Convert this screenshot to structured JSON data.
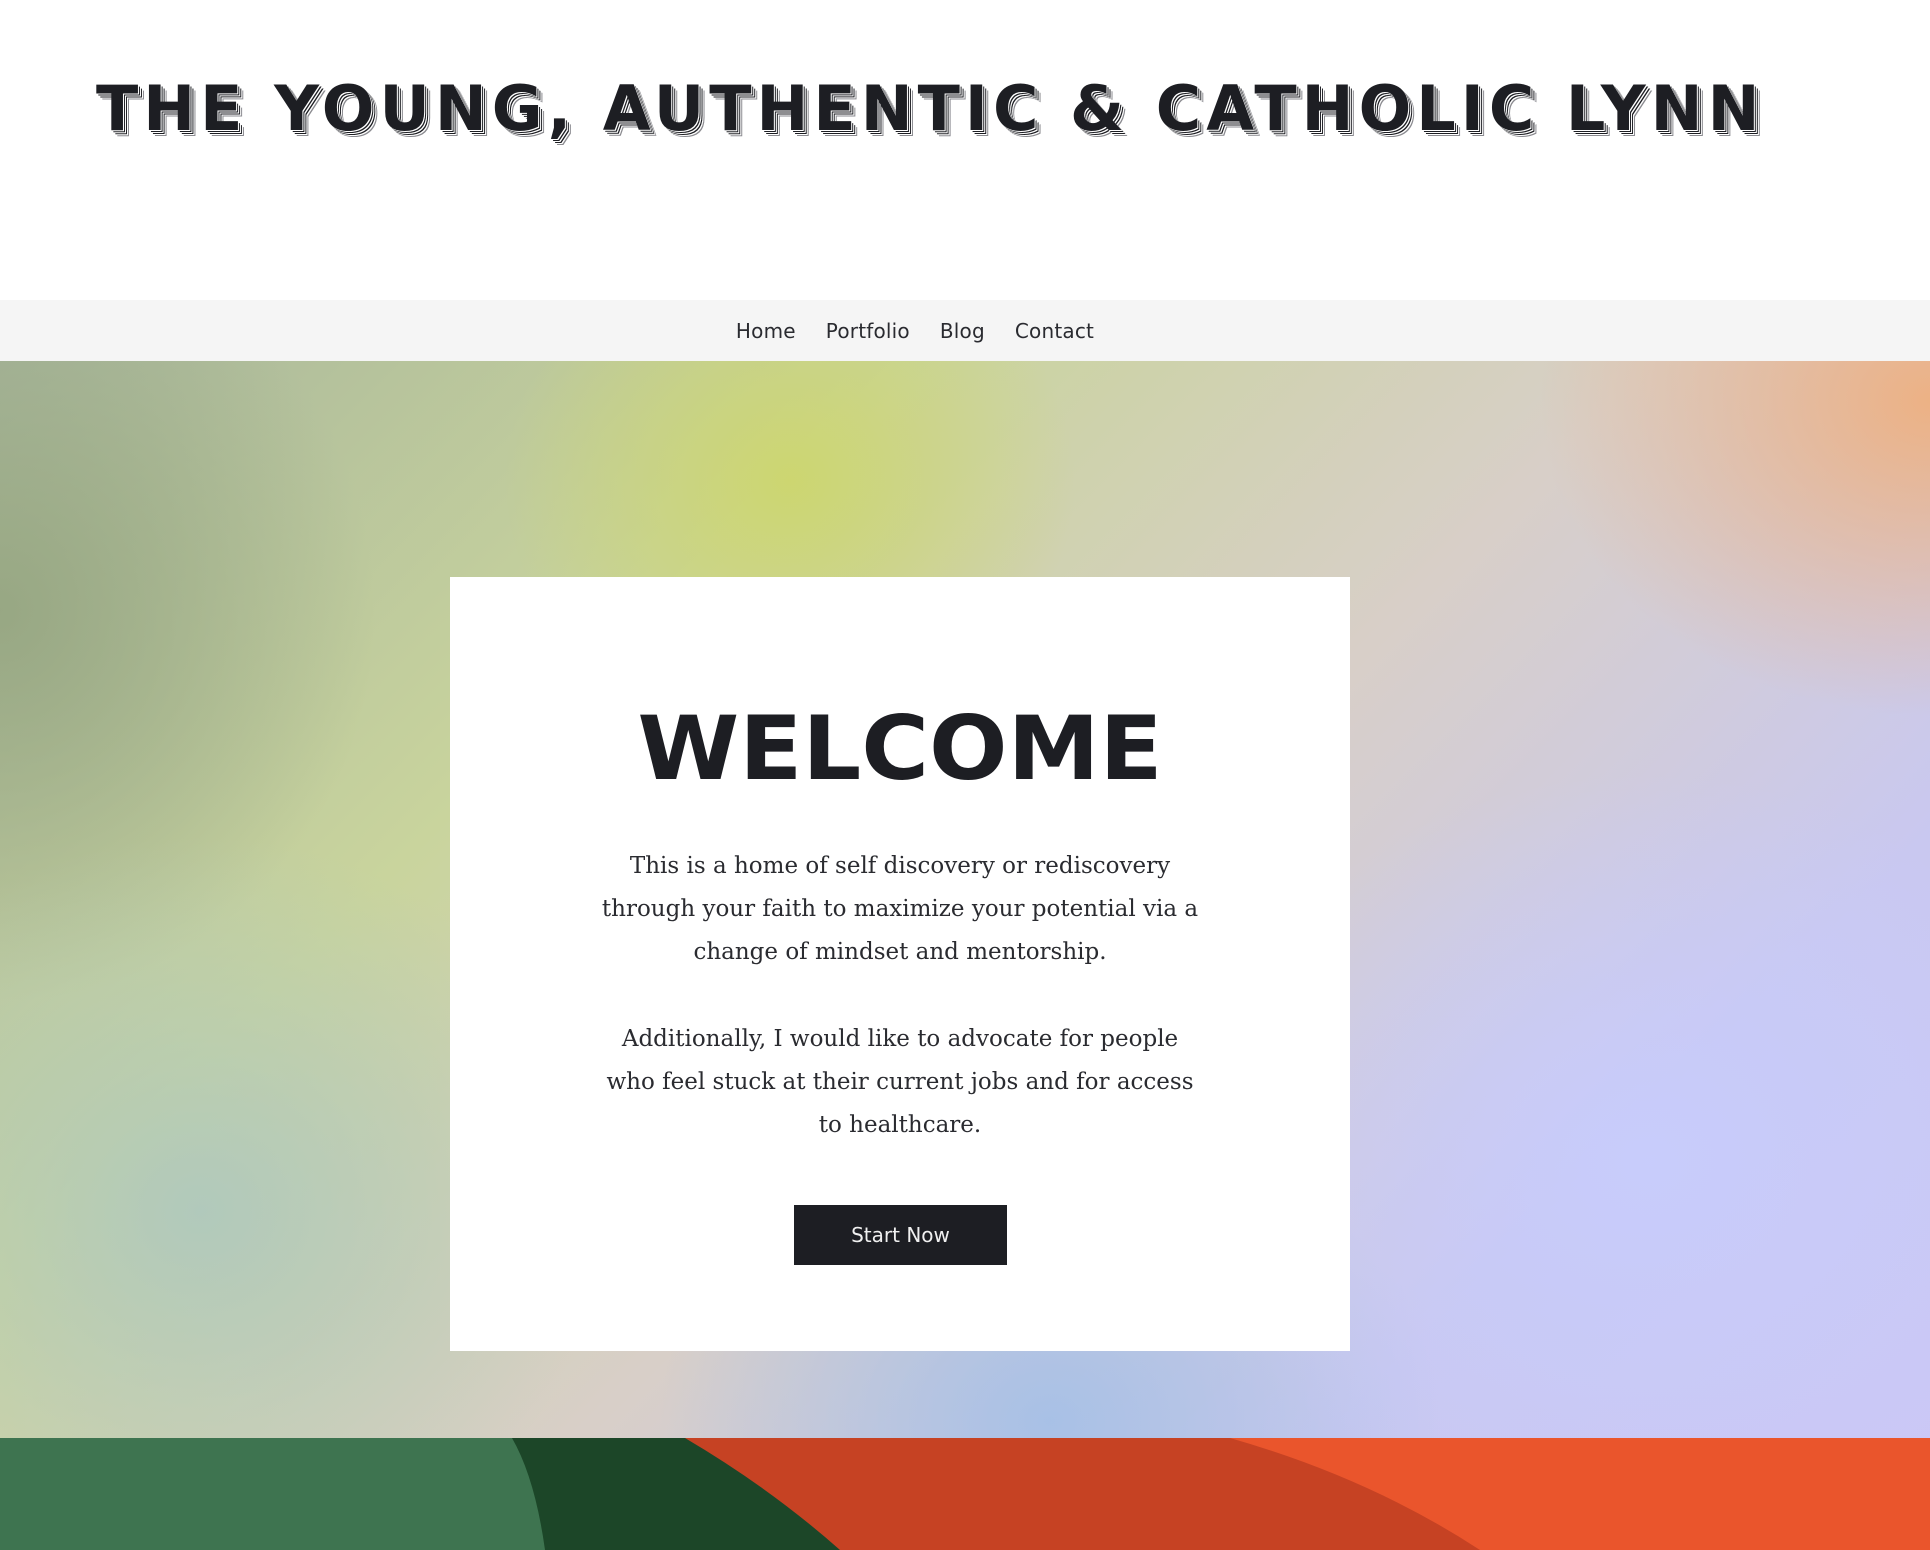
{
  "header": {
    "site_title": "THE YOUNG, AUTHENTIC & CATHOLIC LYNN"
  },
  "nav": {
    "items": [
      {
        "label": "Home"
      },
      {
        "label": "Portfolio"
      },
      {
        "label": "Blog"
      },
      {
        "label": "Contact"
      }
    ]
  },
  "hero": {
    "heading": "WELCOME",
    "paragraph_1": "This is a home of self discovery or rediscovery through your faith to maximize your potential via a change of mindset  and mentorship.",
    "paragraph_2": "Additionally, I would like to advocate for people who feel stuck at their current jobs and for access to healthcare.",
    "button_label": "Start Now"
  },
  "colors": {
    "text_dark": "#1d1e23",
    "nav_background": "#f5f5f5",
    "band_green": "#3e7450",
    "band_dark_green": "#1c4628",
    "band_red": "#c64223",
    "band_orange": "#ea552c"
  }
}
